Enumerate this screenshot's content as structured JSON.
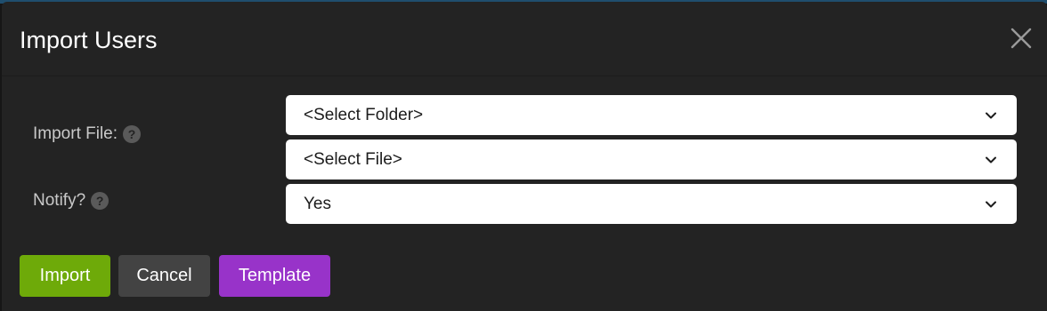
{
  "dialog": {
    "title": "Import Users",
    "close_icon": "close-icon"
  },
  "form": {
    "import_file": {
      "label": "Import File:",
      "help_icon": "question-circle-icon",
      "folder_select": {
        "selected": "<Select Folder>"
      },
      "file_select": {
        "selected": "<Select File>"
      }
    },
    "notify": {
      "label": "Notify?",
      "help_icon": "question-circle-icon",
      "select": {
        "selected": "Yes"
      }
    }
  },
  "buttons": {
    "import": "Import",
    "cancel": "Cancel",
    "template": "Template"
  },
  "colors": {
    "import": "#6eaa09",
    "cancel": "#434343",
    "template": "#9833c9",
    "background": "#232323"
  }
}
